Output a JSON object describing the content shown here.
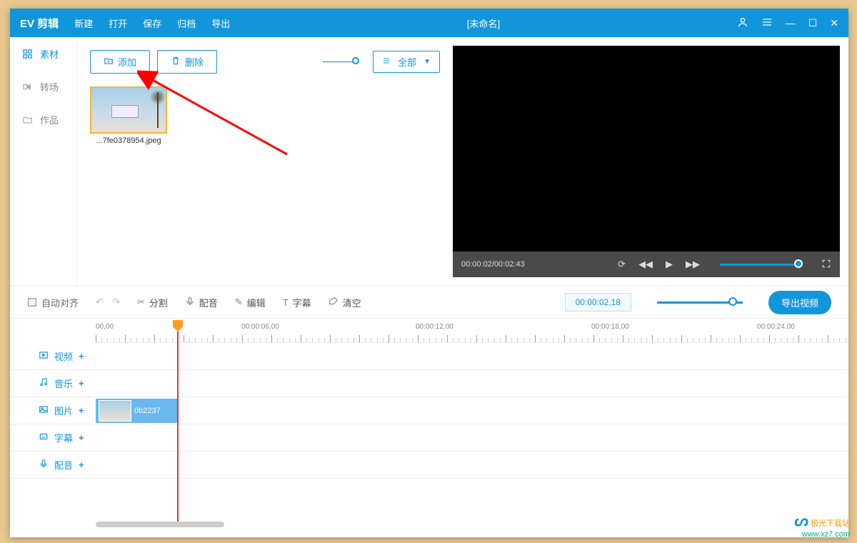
{
  "titlebar": {
    "logo": "EV 剪辑",
    "menu": {
      "new": "新建",
      "open": "打开",
      "save": "保存",
      "archive": "归档",
      "export": "导出"
    },
    "doc_title": "[未命名]"
  },
  "sidebar": {
    "items": [
      {
        "label": "素材",
        "icon": "grid-icon"
      },
      {
        "label": "转场",
        "icon": "transition-icon"
      },
      {
        "label": "作品",
        "icon": "folder-icon"
      }
    ]
  },
  "media": {
    "add_label": "添加",
    "delete_label": "删除",
    "filter_label": "全部",
    "items": [
      {
        "filename": "...7fe0378954.jpeg"
      }
    ]
  },
  "preview": {
    "time_display": "00:00:02/00:02:43"
  },
  "toolbar": {
    "auto_align": "自动对齐",
    "split": "分割",
    "dub": "配音",
    "edit": "编辑",
    "subtitle": "字幕",
    "clear": "清空",
    "timecode": "00:00:02,18",
    "export_video": "导出视频"
  },
  "ruler": {
    "labels": [
      "00,00",
      "00:00:06,00",
      "00:00:12,00",
      "00:00:18,00",
      "00:00:24,00"
    ]
  },
  "tracks": {
    "video": "视频",
    "music": "音乐",
    "image": "图片",
    "subtitle": "字幕",
    "dub": "配音",
    "image_clip_label": "0b2237"
  },
  "watermark": {
    "brand": "极光下载站",
    "url": "www.xz7.com"
  }
}
